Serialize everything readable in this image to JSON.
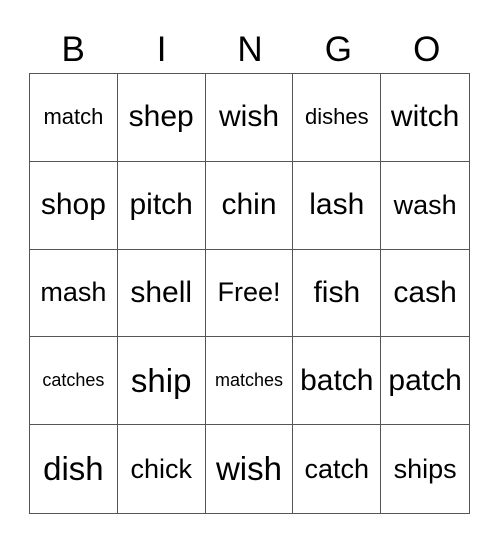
{
  "header": {
    "letters": [
      "B",
      "I",
      "N",
      "G",
      "O"
    ]
  },
  "cells": [
    "match",
    "shep",
    "wish",
    "dishes",
    "witch",
    "shop",
    "pitch",
    "chin",
    "lash",
    "wash",
    "mash",
    "shell",
    "Free!",
    "fish",
    "cash",
    "catches",
    "ship",
    "matches",
    "batch",
    "patch",
    "dish",
    "chick",
    "wish",
    "catch",
    "ships"
  ]
}
